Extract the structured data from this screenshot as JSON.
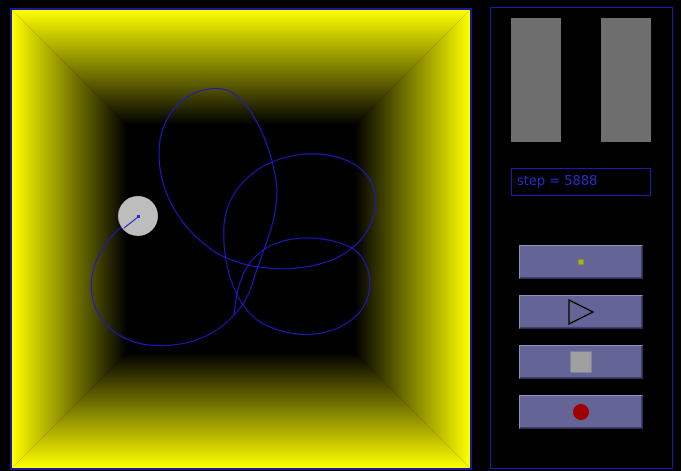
{
  "status": {
    "step_label": "step = 5888"
  },
  "colors": {
    "wall": "#ffff00",
    "floor": "#000000",
    "trajectory": "#1a1ac8",
    "particle": "#bdbdbd",
    "button_face": "#646496",
    "record": "#a00000"
  },
  "icons": {
    "step": "small-square-icon",
    "play": "play-triangle-icon",
    "stop": "stop-square-icon",
    "record": "record-circle-icon"
  }
}
